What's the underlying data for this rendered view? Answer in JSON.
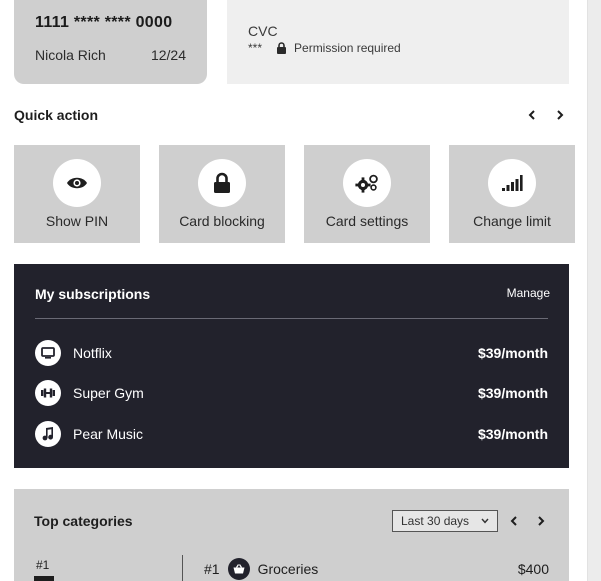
{
  "card": {
    "number": "1111 **** **** 0000",
    "holder": "Nicola Rich",
    "expiry": "12/24"
  },
  "cvc": {
    "label": "CVC",
    "mask": "***",
    "permission": "Permission required"
  },
  "quick_action": {
    "title": "Quick action",
    "tiles": [
      {
        "label": "Show PIN",
        "icon": "eye-icon"
      },
      {
        "label": "Card blocking",
        "icon": "lock-icon"
      },
      {
        "label": "Card settings",
        "icon": "gears-icon"
      },
      {
        "label": "Change limit",
        "icon": "signal-bars-icon"
      }
    ]
  },
  "subscriptions": {
    "title": "My subscriptions",
    "manage_label": "Manage",
    "items": [
      {
        "name": "Notflix",
        "price": "$39/month",
        "icon": "tv-icon"
      },
      {
        "name": "Super Gym",
        "price": "$39/month",
        "icon": "dumbbell-icon"
      },
      {
        "name": "Pear Music",
        "price": "$39/month",
        "icon": "music-note-icon"
      }
    ]
  },
  "top_categories": {
    "title": "Top categories",
    "period": "Last 30 days",
    "left_rank": "#1",
    "rows": [
      {
        "rank": "#1",
        "name": "Groceries",
        "amount": "$400",
        "icon": "basket-icon"
      }
    ]
  },
  "colors": {
    "tile_bg": "#cfcfcf",
    "dark_panel": "#22222c",
    "cvc_bg": "#efefef"
  }
}
